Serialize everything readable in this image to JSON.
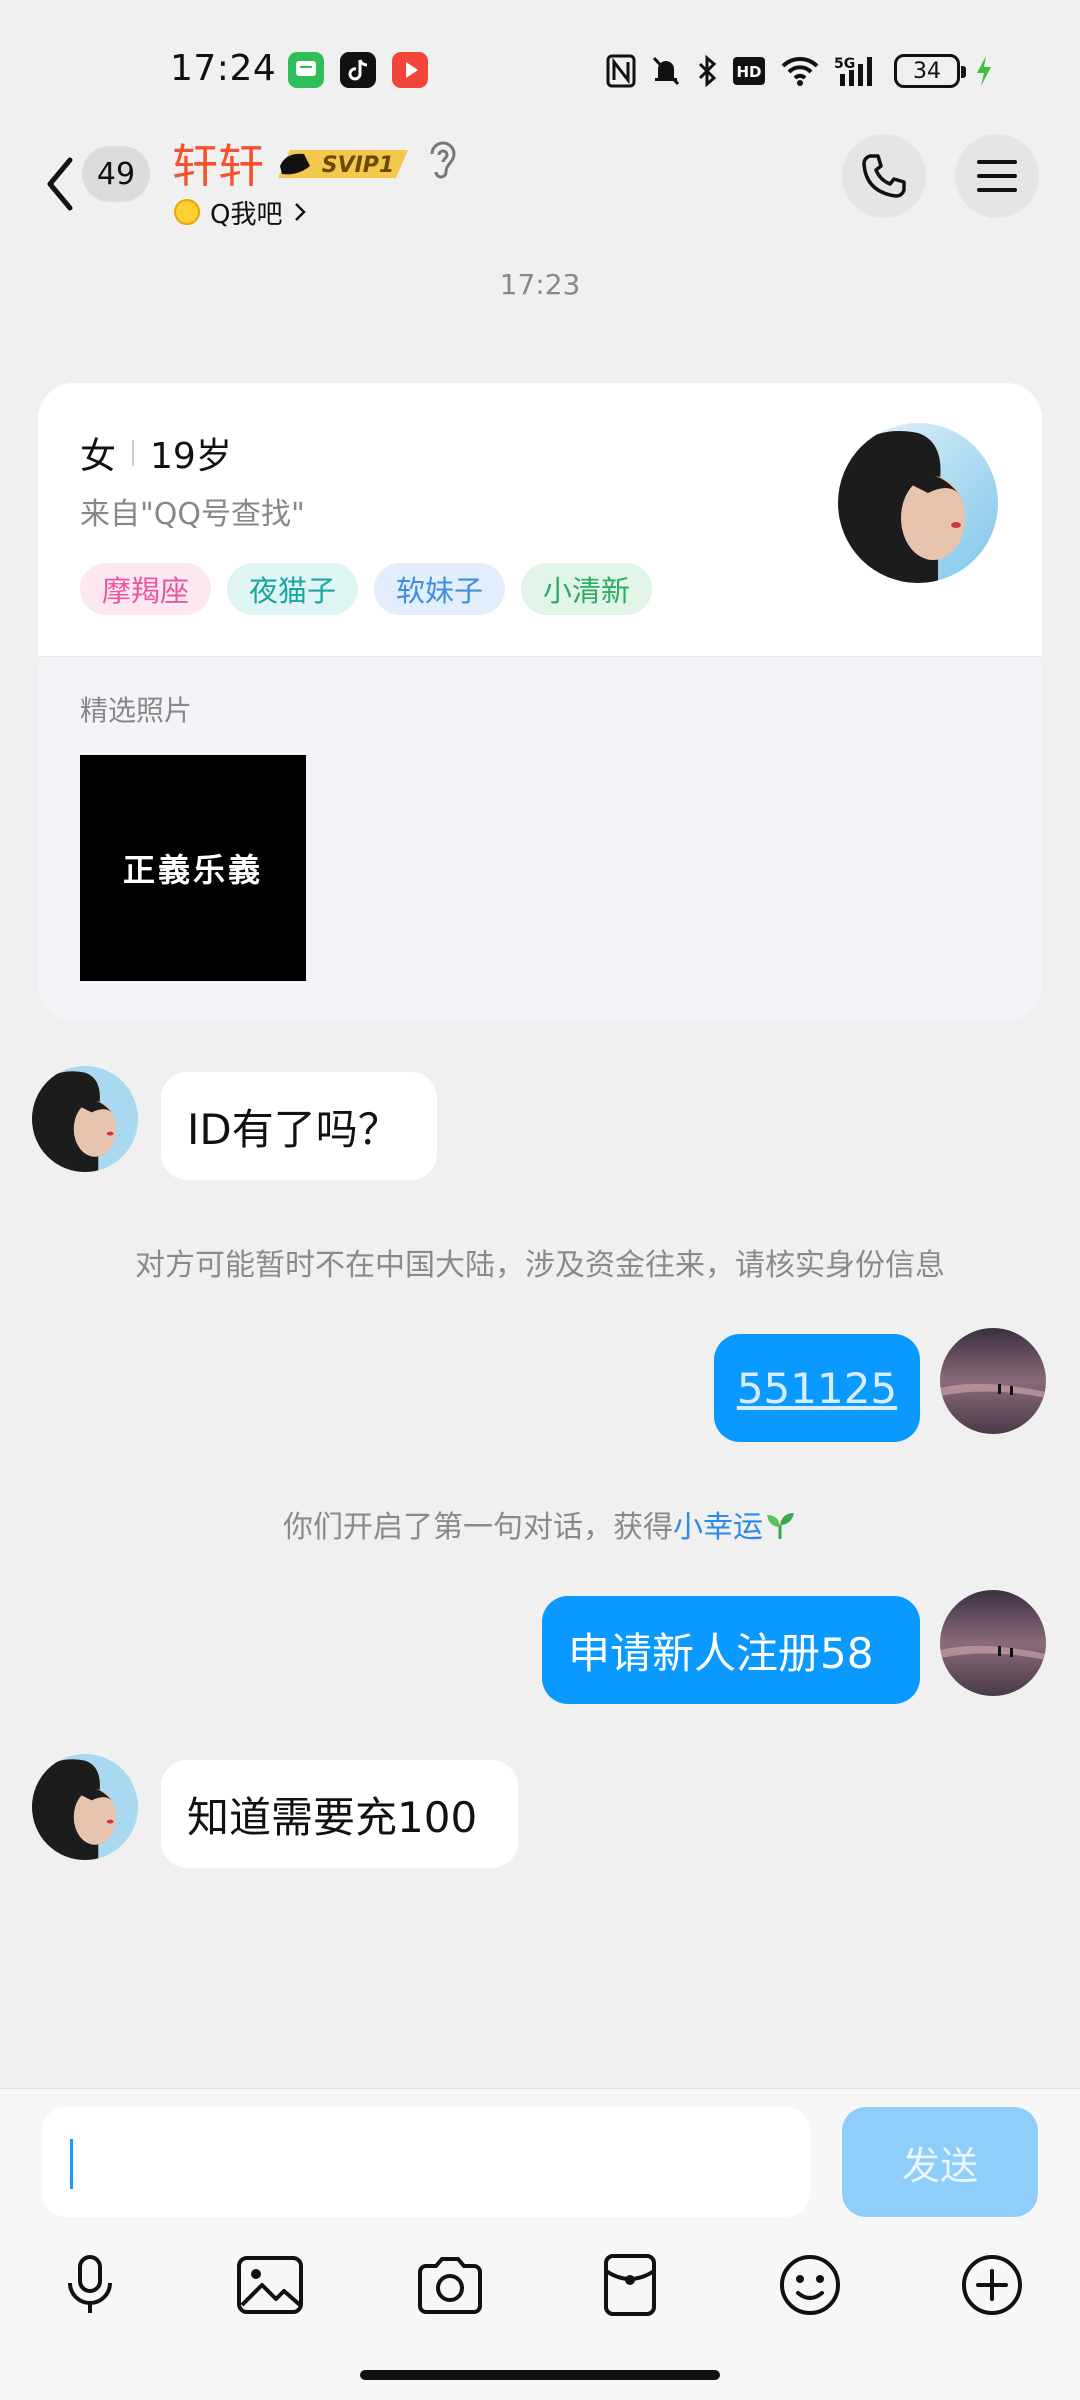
{
  "status_bar": {
    "time": "17:24",
    "battery": "34",
    "icons": [
      "messages-app-icon",
      "tiktok-app-icon",
      "video-app-icon",
      "nfc-icon",
      "mute-icon",
      "bluetooth-icon",
      "hd-icon",
      "wifi-icon",
      "5g-signal-icon",
      "battery-icon",
      "charging-icon"
    ]
  },
  "header": {
    "unread_count": "49",
    "name": "轩轩",
    "vip_badge": "SVIP1",
    "status_text": "Q我吧",
    "icons": [
      "back-icon",
      "ear-icon",
      "phone-icon",
      "menu-icon"
    ]
  },
  "chat": {
    "timestamp": "17:23",
    "profile_card": {
      "gender": "女",
      "age": "19岁",
      "source": "来自\"QQ号查找\"",
      "tags": [
        {
          "label": "摩羯座",
          "color": "#e8569f",
          "bg": "#fde8f2"
        },
        {
          "label": "夜猫子",
          "color": "#1aa6a0",
          "bg": "#dff5f3"
        },
        {
          "label": "软妹子",
          "color": "#3f8fe0",
          "bg": "#e2eefb"
        },
        {
          "label": "小清新",
          "color": "#2faa62",
          "bg": "#e0f5e8"
        }
      ],
      "photos_label": "精选照片",
      "photo_text": "正義乐義"
    },
    "messages": [
      {
        "from": "them",
        "text": "ID有了吗？"
      },
      {
        "type": "system",
        "text": "对方可能暂时不在中国大陆，涉及资金往来，请核实身份信息"
      },
      {
        "from": "me",
        "text": "551125"
      },
      {
        "type": "system",
        "text_before": "你们开启了第一句对话，获得",
        "text_link": "小幸运"
      },
      {
        "from": "me",
        "text": "申请新人注册58"
      },
      {
        "from": "them",
        "text": "知道需要充100"
      }
    ]
  },
  "input_bar": {
    "value": "",
    "send_label": "发送",
    "tools": [
      "microphone-icon",
      "image-icon",
      "camera-icon",
      "red-packet-icon",
      "emoji-icon",
      "plus-icon"
    ]
  },
  "colors": {
    "accent": "#0a99ff",
    "name_color": "#f5522f",
    "send_disabled": "#8fcdfb"
  }
}
